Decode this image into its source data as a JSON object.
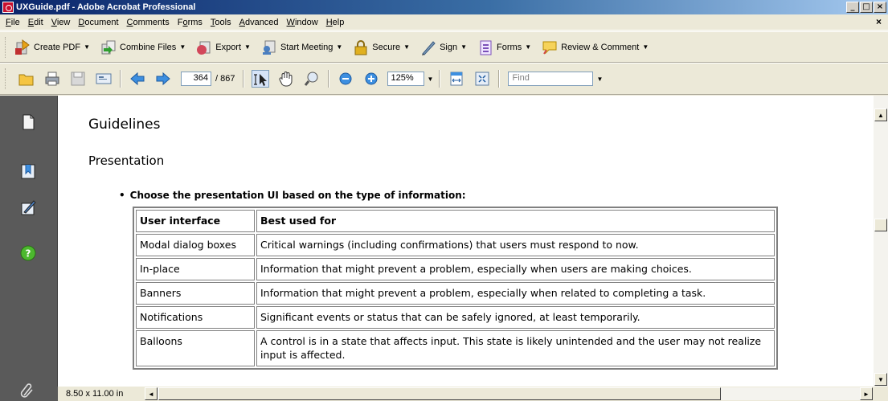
{
  "window": {
    "title": "UXGuide.pdf - Adobe Acrobat Professional",
    "minimize": "_",
    "maximize": "□",
    "close": "×"
  },
  "menubar": {
    "items": [
      {
        "pre": "",
        "u": "F",
        "post": "ile"
      },
      {
        "pre": "",
        "u": "E",
        "post": "dit"
      },
      {
        "pre": "",
        "u": "V",
        "post": "iew"
      },
      {
        "pre": "",
        "u": "D",
        "post": "ocument"
      },
      {
        "pre": "",
        "u": "C",
        "post": "omments"
      },
      {
        "pre": "F",
        "u": "o",
        "post": "rms"
      },
      {
        "pre": "",
        "u": "T",
        "post": "ools"
      },
      {
        "pre": "",
        "u": "A",
        "post": "dvanced"
      },
      {
        "pre": "",
        "u": "W",
        "post": "indow"
      },
      {
        "pre": "",
        "u": "H",
        "post": "elp"
      }
    ],
    "close_doc": "×"
  },
  "tasks": {
    "create_pdf": "Create PDF",
    "combine_files": "Combine Files",
    "export": "Export",
    "start_meeting": "Start Meeting",
    "secure": "Secure",
    "sign": "Sign",
    "forms": "Forms",
    "review_comment": "Review & Comment",
    "caret": "▼"
  },
  "nav": {
    "page_current": "364",
    "page_total": "/ 867",
    "zoom": "125%",
    "find_placeholder": "Find",
    "caret": "▼"
  },
  "document": {
    "heading": "Guidelines",
    "subheading": "Presentation",
    "bullet": "Choose the presentation UI based on the type of information:",
    "table": {
      "headers": [
        "User interface",
        "Best used for"
      ],
      "rows": [
        [
          "Modal dialog boxes",
          "Critical warnings (including confirmations) that users must respond to now."
        ],
        [
          "In-place",
          "Information that might prevent a problem, especially when users are making choices."
        ],
        [
          "Banners",
          "Information that might prevent a problem, especially when related to completing a task."
        ],
        [
          "Notifications",
          "Significant events or status that can be safely ignored, at least temporarily."
        ],
        [
          "Balloons",
          "A control is in a state that affects input. This state is likely unintended and the user may not realize input is affected."
        ]
      ]
    }
  },
  "status": {
    "page_size": "8.50 x 11.00 in"
  },
  "scroll": {
    "up": "▲",
    "down": "▼",
    "left": "◄",
    "right": "►"
  },
  "colors": {
    "title_gradient_start": "#0a246a",
    "pane_gray": "#5a5a5a",
    "chrome": "#ece9d8"
  }
}
